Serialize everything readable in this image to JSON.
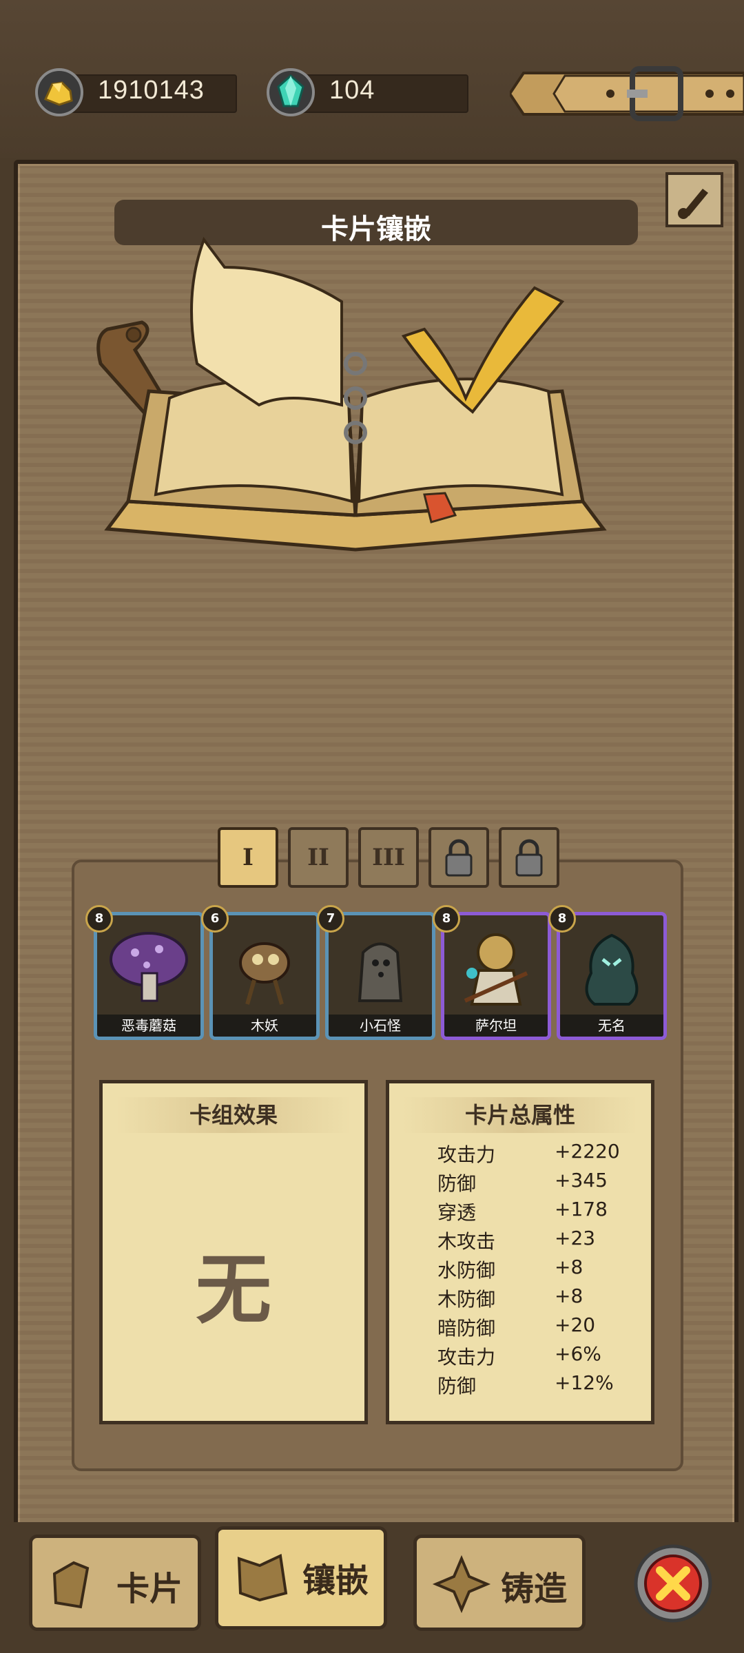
{
  "currency": {
    "gold": "1910143",
    "gems": "104"
  },
  "title": "卡片镶嵌",
  "tabs": [
    "I",
    "II",
    "III"
  ],
  "cards": [
    {
      "level": "8",
      "name": "恶毒蘑菇",
      "frame": "blue"
    },
    {
      "level": "6",
      "name": "木妖",
      "frame": "blue"
    },
    {
      "level": "7",
      "name": "小石怪",
      "frame": "blue"
    },
    {
      "level": "8",
      "name": "萨尔坦",
      "frame": "purple"
    },
    {
      "level": "8",
      "name": "无名",
      "frame": "purple"
    }
  ],
  "deck_effect": {
    "header": "卡组效果",
    "value": "无"
  },
  "stats": {
    "header": "卡片总属性",
    "items": [
      {
        "label": "攻击力",
        "value": "+2220"
      },
      {
        "label": "防御",
        "value": "+345"
      },
      {
        "label": "穿透",
        "value": "+178"
      },
      {
        "label": "木攻击",
        "value": "+23"
      },
      {
        "label": "水防御",
        "value": "+8"
      },
      {
        "label": "木防御",
        "value": "+8"
      },
      {
        "label": "暗防御",
        "value": "+20"
      },
      {
        "label": "攻击力",
        "value": "+6%"
      },
      {
        "label": "防御",
        "value": "+12%"
      }
    ]
  },
  "nav": {
    "cards": "卡片",
    "inlay": "镶嵌",
    "forge": "铸造"
  },
  "colors": {
    "panel": "#8a7355",
    "parchment": "#eedfab",
    "blue_frame": "#5b93b6",
    "purple_frame": "#8d5bd6",
    "close_red": "#d9332a"
  }
}
